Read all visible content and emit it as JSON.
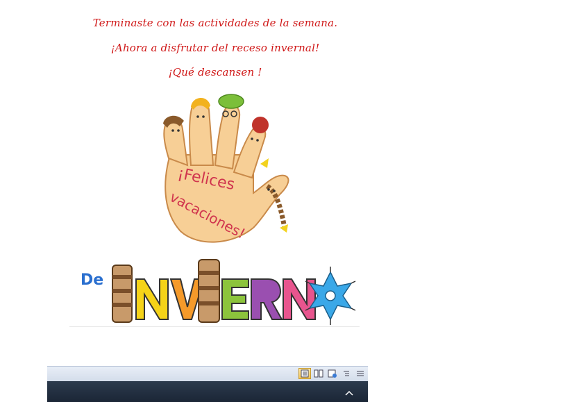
{
  "message": {
    "line1": "Terminaste con las actividades de la semana.",
    "line2": "¡Ahora a disfrutar del receso invernal!",
    "line3": "¡Qué descansen !"
  },
  "hand_image": {
    "text_line1": "¡Felices",
    "text_line2": "vacaciones!"
  },
  "winter_banner": {
    "prefix": "De",
    "letters": [
      "I",
      "N",
      "V",
      "I",
      "E",
      "R",
      "N"
    ]
  },
  "statusbar": {
    "view_buttons": [
      "print-layout-icon",
      "full-screen-reading-icon",
      "web-layout-icon",
      "outline-icon",
      "draft-icon"
    ]
  },
  "colors": {
    "message_text": "#d01818",
    "de_blue": "#2a6fcf",
    "letter_yellow": "#f5d318",
    "letter_orange": "#f59a2a",
    "letter_green": "#8cc43c",
    "letter_purple": "#9a4fb0",
    "letter_pink": "#e8558e",
    "snowflake_blue": "#3aa8e8",
    "hand_skin": "#f7cf96",
    "hand_text": "#d0354e"
  }
}
